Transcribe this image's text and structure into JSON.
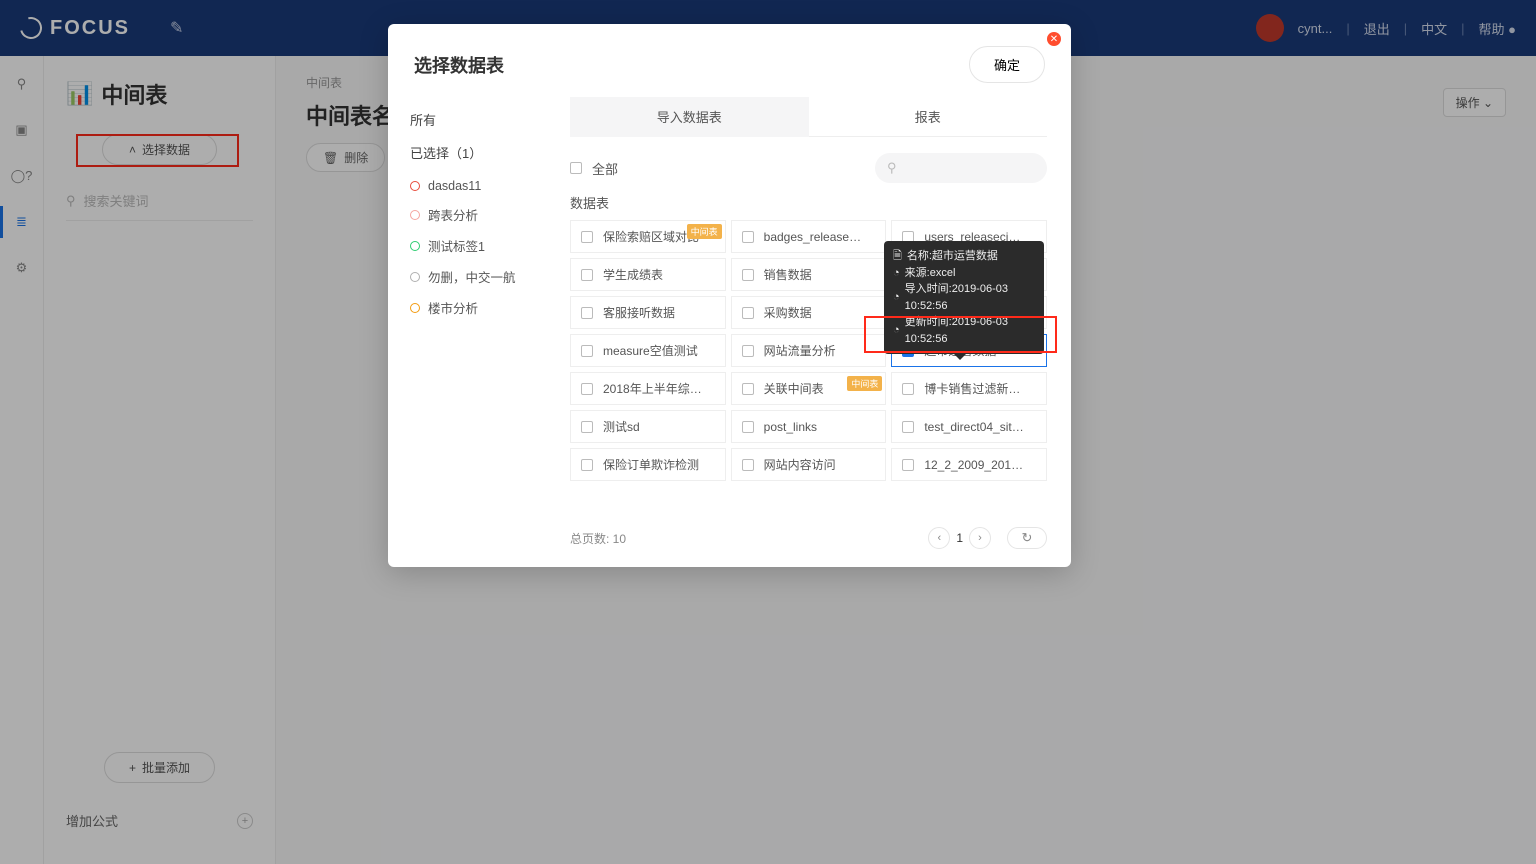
{
  "header": {
    "brand": "FOCUS",
    "user": "cynt...",
    "logout": "退出",
    "lang": "中文",
    "help": "帮助"
  },
  "page": {
    "title": "中间表",
    "select_data_btn": "选择数据",
    "search_placeholder": "搜索关键词",
    "batch_add": "批量添加",
    "add_formula": "增加公式",
    "breadcrumb": "中间表",
    "content_title": "中间表名",
    "delete_btn": "删除",
    "ops_btn": "操作"
  },
  "modal": {
    "title": "选择数据表",
    "confirm": "确定",
    "cat_all": "所有",
    "cat_selected": "已选择（1）",
    "tags": [
      {
        "color": "red",
        "label": "dasdas11"
      },
      {
        "color": "pink",
        "label": "跨表分析"
      },
      {
        "color": "green",
        "label": "测试标签1"
      },
      {
        "color": "gray",
        "label": "勿删，中交一航"
      },
      {
        "color": "orange",
        "label": "楼市分析"
      }
    ],
    "tab_import": "导入数据表",
    "tab_report": "报表",
    "all_label": "全部",
    "section_label": "数据表",
    "tables": [
      {
        "label": "保险索赔区域对比",
        "badge": "mid"
      },
      {
        "label": "badges_releaseci_m8..."
      },
      {
        "label": "users_releaseci_p186..."
      },
      {
        "label": "学生成绩表"
      },
      {
        "label": "销售数据"
      },
      {
        "label": "",
        "badge": "excel",
        "hidden_under_tooltip": true
      },
      {
        "label": "客服接听数据"
      },
      {
        "label": "采购数据"
      },
      {
        "label": ""
      },
      {
        "label": "measure空值测试"
      },
      {
        "label": "网站流量分析"
      },
      {
        "label": "超市运营数据",
        "selected": true
      },
      {
        "label": "2018年上半年综合明..."
      },
      {
        "label": "关联中间表",
        "badge": "mid"
      },
      {
        "label": "博卡销售过滤新增数据..."
      },
      {
        "label": "测试sd"
      },
      {
        "label": "post_links"
      },
      {
        "label": "test_direct04_sit_m5..."
      },
      {
        "label": "保险订单欺诈检测"
      },
      {
        "label": "网站内容访问"
      },
      {
        "label": "12_2_2009_2017年G..."
      }
    ],
    "total_pages_label": "总页数: 10",
    "current_page": "1"
  },
  "tooltip": {
    "name_label": "名称:超市运营数据",
    "source_label": "来源:excel",
    "import_time": "导入时间:2019-06-03 10:52:56",
    "update_time": "更新时间:2019-06-03 10:52:56"
  }
}
